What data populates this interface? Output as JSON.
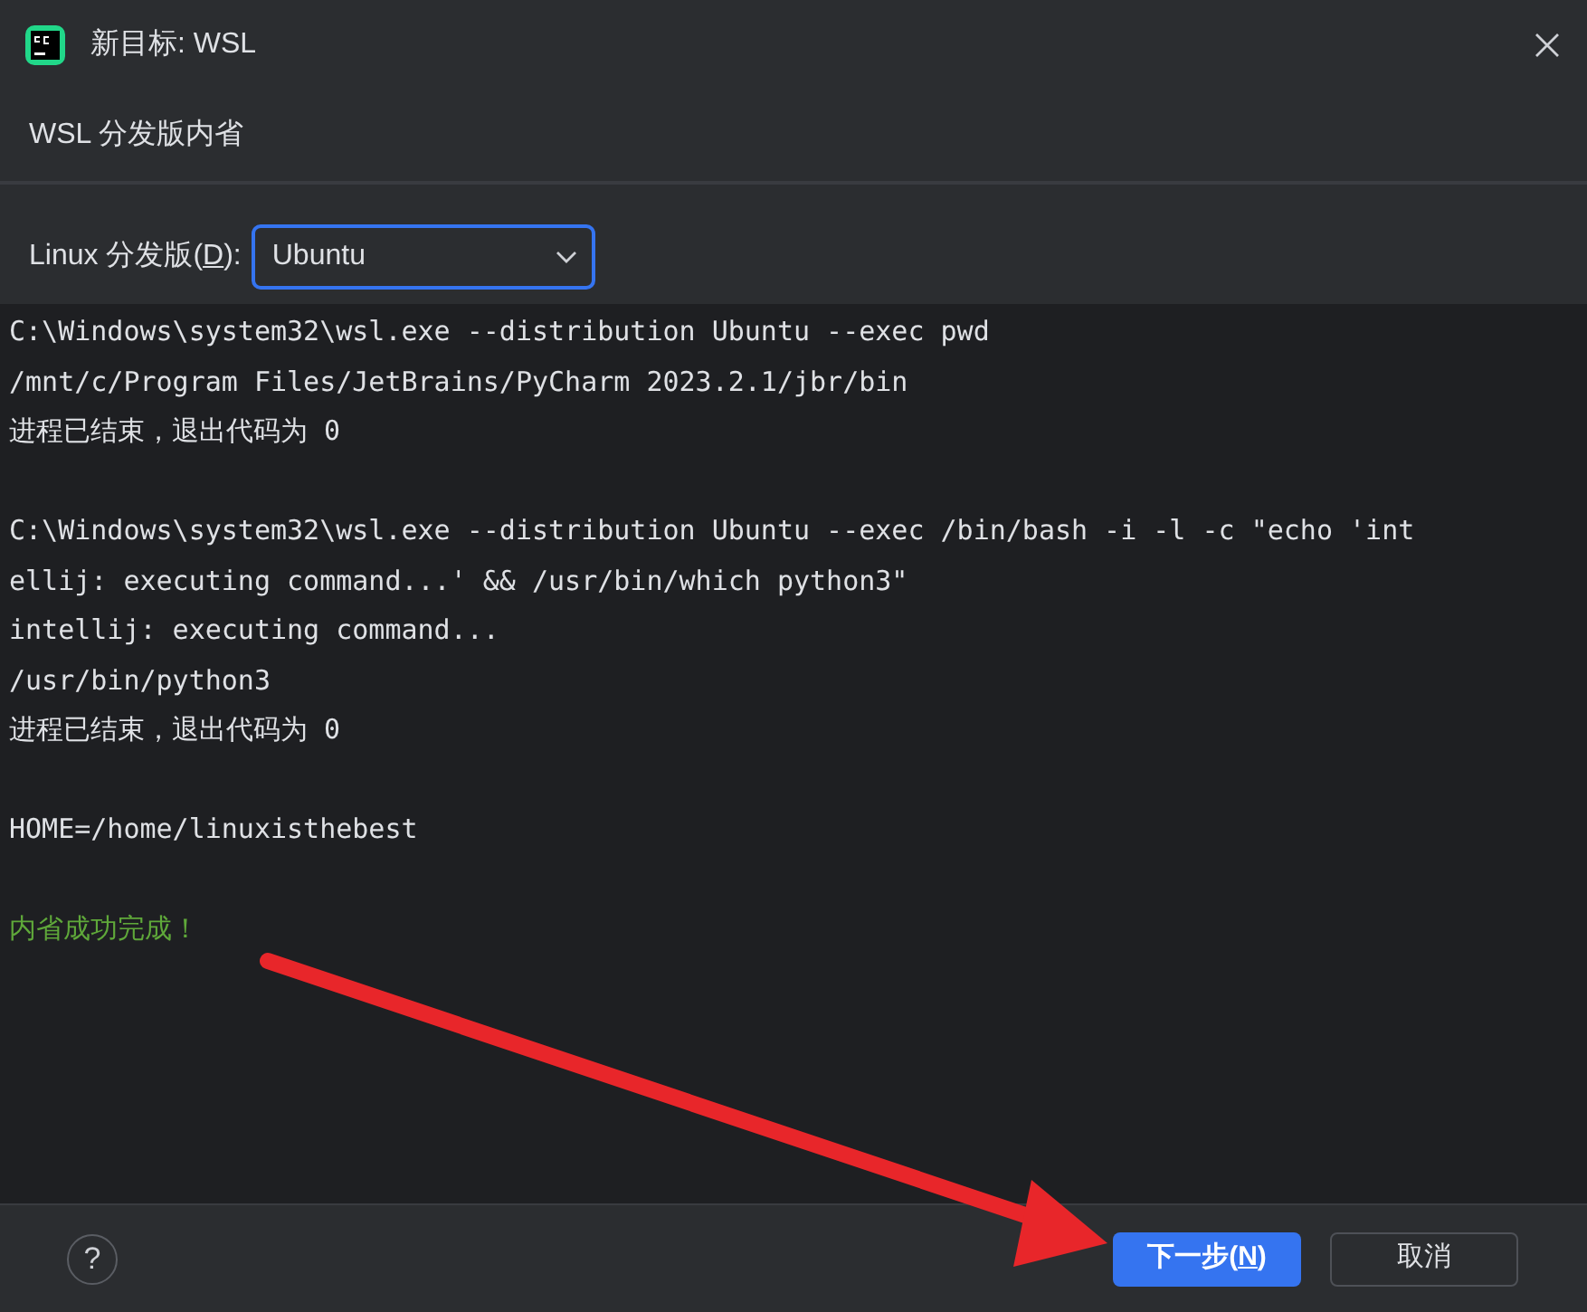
{
  "window": {
    "title": "新目标: WSL"
  },
  "step_title": "WSL 分发版内省",
  "distribution": {
    "label_before": "Linux 分发版(",
    "mnemonic": "D",
    "label_after": "):",
    "value": "Ubuntu"
  },
  "console": [
    {
      "kind": "normal",
      "text": "C:\\Windows\\system32\\wsl.exe --distribution Ubuntu --exec pwd"
    },
    {
      "kind": "normal",
      "text": "/mnt/c/Program Files/JetBrains/PyCharm 2023.2.1/jbr/bin"
    },
    {
      "kind": "normal",
      "text": "进程已结束，退出代码为 0"
    },
    {
      "kind": "blank"
    },
    {
      "kind": "normal",
      "text": "C:\\Windows\\system32\\wsl.exe --distribution Ubuntu --exec /bin/bash -i -l -c \"echo 'int"
    },
    {
      "kind": "normal",
      "text": "ellij: executing command...' && /usr/bin/which python3\""
    },
    {
      "kind": "normal",
      "text": "intellij: executing command..."
    },
    {
      "kind": "normal",
      "text": "/usr/bin/python3"
    },
    {
      "kind": "normal",
      "text": "进程已结束，退出代码为 0"
    },
    {
      "kind": "blank"
    },
    {
      "kind": "normal",
      "text": "HOME=/home/linuxisthebest"
    },
    {
      "kind": "blank"
    },
    {
      "kind": "success",
      "text": "内省成功完成！"
    }
  ],
  "help_button": "?",
  "buttons": [
    {
      "kind": "primary",
      "label_before": "下一步(",
      "mnemonic": "N",
      "label_after": ")"
    },
    {
      "kind": "secondary",
      "label": "取消"
    }
  ]
}
